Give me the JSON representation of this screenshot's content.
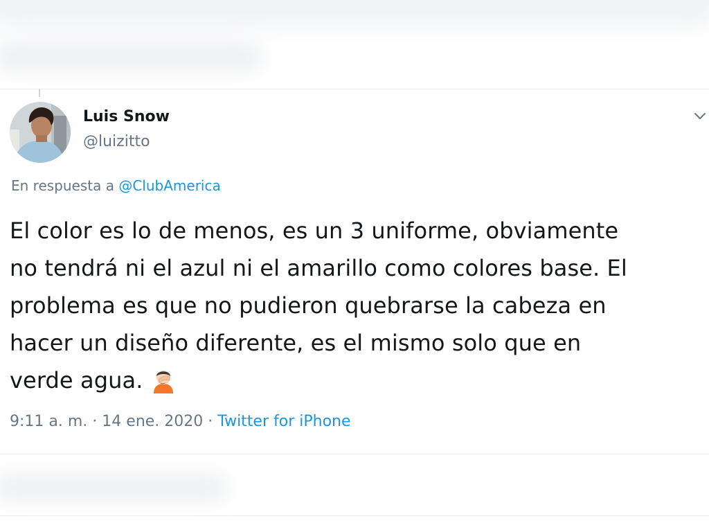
{
  "tweet": {
    "author": {
      "name": "Luis Snow",
      "handle": "@luizitto"
    },
    "reply": {
      "prefix": "En respuesta a",
      "mention": "@ClubAmerica"
    },
    "lines": [
      "El color es lo de menos, es un 3 uniforme, obviamente",
      "no tendrá ni el azul ni el amarillo como colores base. El",
      "problema es que no pudieron quebrarse la cabeza en",
      "hacer un diseño diferente, es el mismo solo que en",
      "verde agua."
    ],
    "emoji": "facepalm-emoji",
    "meta": {
      "time": "9:11 a. m.",
      "separator": "·",
      "date": "14 ene. 2020",
      "source": "Twitter for iPhone"
    }
  },
  "icons": {
    "menu": "chevron-down-icon"
  },
  "colors": {
    "text": "#14171a",
    "secondary": "#657786",
    "link": "#1b95e0",
    "divider": "#e6ecf0"
  }
}
